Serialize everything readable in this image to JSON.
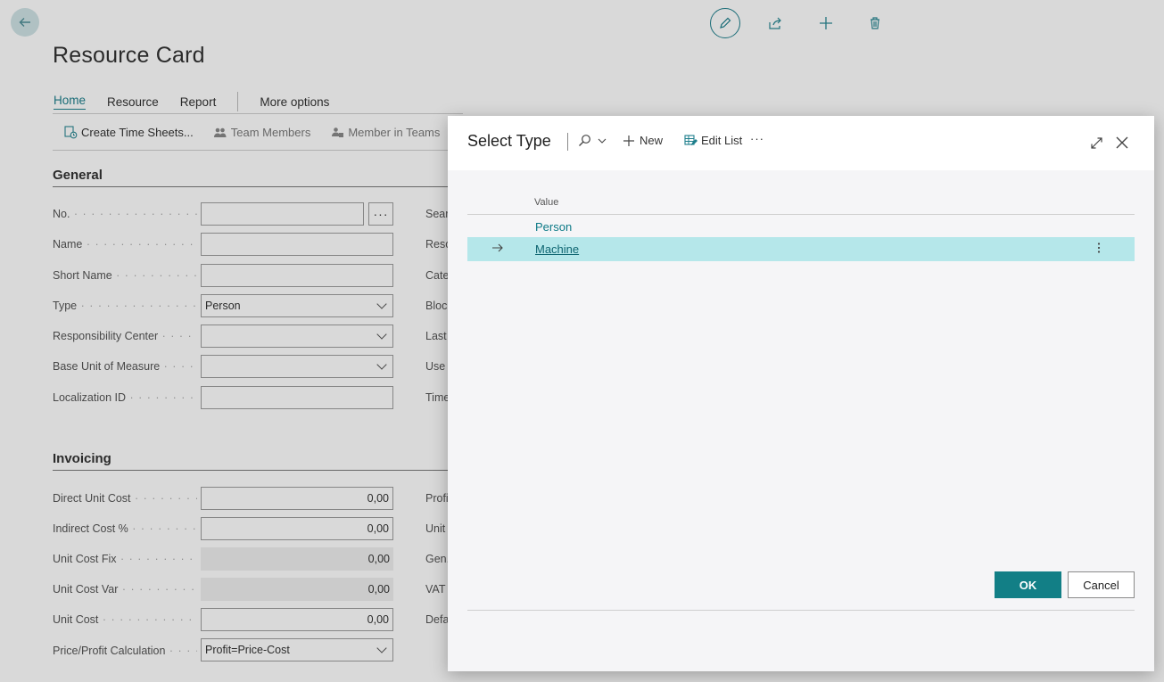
{
  "page": {
    "title": "Resource Card",
    "tabs": [
      "Home",
      "Resource",
      "Report",
      "More options"
    ],
    "actions": [
      "Create Time Sheets...",
      "Team Members",
      "Member in Teams"
    ],
    "general": {
      "title": "General",
      "fields": [
        {
          "label": "No.",
          "value": ""
        },
        {
          "label": "Name",
          "value": ""
        },
        {
          "label": "Short Name",
          "value": ""
        },
        {
          "label": "Type",
          "value": "Person"
        },
        {
          "label": "Responsibility Center",
          "value": ""
        },
        {
          "label": "Base Unit of Measure",
          "value": ""
        },
        {
          "label": "Localization ID",
          "value": ""
        }
      ],
      "right_labels": [
        "Sear",
        "Reso",
        "Cate",
        "Block",
        "Last",
        "Use",
        "Time"
      ]
    },
    "invoicing": {
      "title": "Invoicing",
      "fields": [
        {
          "label": "Direct Unit Cost",
          "value": "0,00"
        },
        {
          "label": "Indirect Cost %",
          "value": "0,00"
        },
        {
          "label": "Unit Cost Fix",
          "value": "0,00"
        },
        {
          "label": "Unit Cost Var",
          "value": "0,00"
        },
        {
          "label": "Unit Cost",
          "value": "0,00"
        },
        {
          "label": "Price/Profit Calculation",
          "value": "Profit=Price-Cost"
        }
      ],
      "right_labels": [
        "Profi",
        "Unit",
        "Gen.",
        "VAT",
        "Defa"
      ]
    }
  },
  "dialog": {
    "title": "Select Type",
    "new_label": "New",
    "edit_list_label": "Edit List",
    "more_label": "···",
    "column_header": "Value",
    "rows": [
      "Person",
      "Machine"
    ],
    "ok_label": "OK",
    "cancel_label": "Cancel"
  }
}
